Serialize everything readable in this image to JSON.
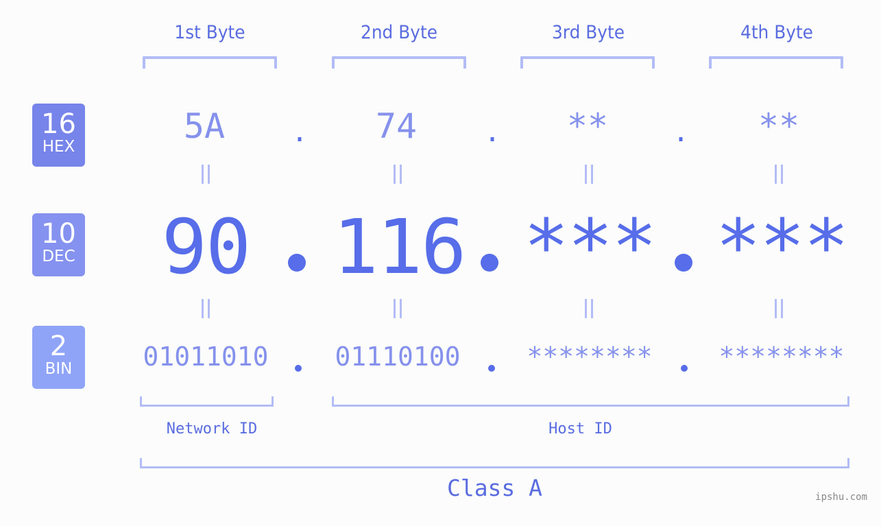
{
  "bytes": {
    "headers": [
      "1st Byte",
      "2nd Byte",
      "3rd Byte",
      "4th Byte"
    ]
  },
  "badges": {
    "hex": {
      "num": "16",
      "base": "HEX",
      "color": "#7784ea"
    },
    "dec": {
      "num": "10",
      "base": "DEC",
      "color": "#8592ef"
    },
    "bin": {
      "num": "2",
      "base": "BIN",
      "color": "#8fa4f7"
    }
  },
  "rows": {
    "hex": [
      "5A",
      "74",
      "**",
      "**"
    ],
    "dec": [
      "90",
      "116",
      "***",
      "***"
    ],
    "bin": [
      "01011010",
      "01110100",
      "********",
      "********"
    ]
  },
  "separator": ".",
  "equals": "=",
  "segments": {
    "network": "Network ID",
    "host": "Host ID"
  },
  "ip_class": "Class A",
  "watermark": "ipshu.com",
  "colors": {
    "primary": "#576de9",
    "light": "#8591ec",
    "bracket": "#b3bcf6",
    "background": "#fbfcfb"
  }
}
